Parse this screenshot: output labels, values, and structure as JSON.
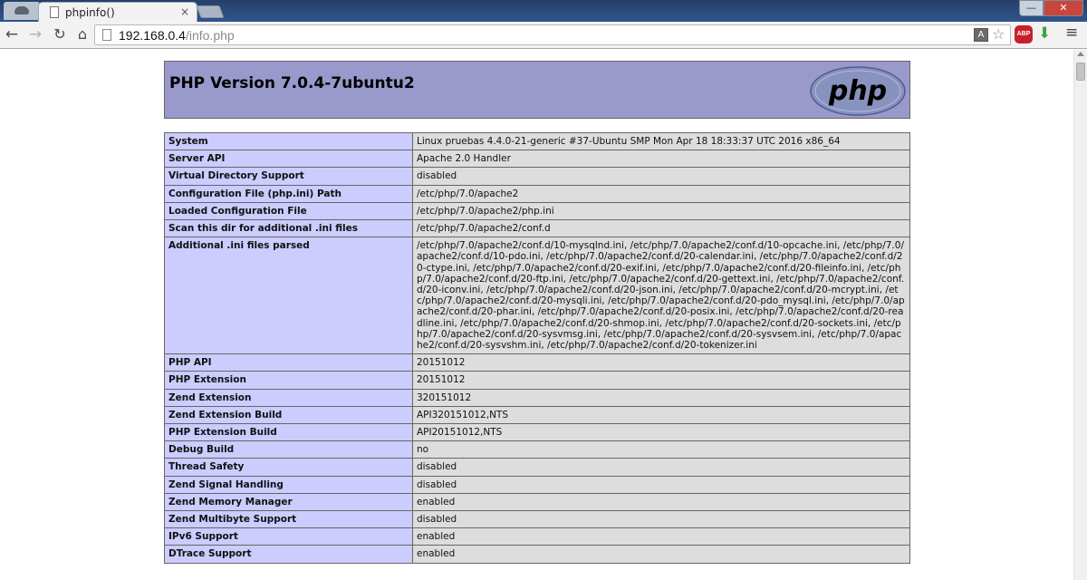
{
  "browser": {
    "tab_title": "phpinfo()",
    "tab_close": "×",
    "window_controls": {
      "minimize": "—",
      "close": "✕"
    },
    "url_host": "192.168.0.4",
    "url_path": "/info.php",
    "icons": {
      "back": "back-arrow-icon",
      "forward": "forward-arrow-icon",
      "reload": "reload-icon",
      "home": "home-icon",
      "translate": "translate-icon",
      "star": "bookmark-star-icon",
      "adblock": "adblock-plus-icon",
      "download": "download-icon",
      "menu": "menu-icon"
    },
    "adblock_label": "ABP"
  },
  "php": {
    "version_title": "PHP Version 7.0.4-7ubuntu2",
    "logo_text": "php",
    "colors": {
      "header": "#9999cc",
      "label_cell": "#ccccff",
      "value_cell": "#dddddd"
    },
    "rows": [
      {
        "label": "System",
        "value": "Linux pruebas 4.4.0-21-generic #37-Ubuntu SMP Mon Apr 18 18:33:37 UTC 2016 x86_64"
      },
      {
        "label": "Server API",
        "value": "Apache 2.0 Handler"
      },
      {
        "label": "Virtual Directory Support",
        "value": "disabled"
      },
      {
        "label": "Configuration File (php.ini) Path",
        "value": "/etc/php/7.0/apache2"
      },
      {
        "label": "Loaded Configuration File",
        "value": "/etc/php/7.0/apache2/php.ini"
      },
      {
        "label": "Scan this dir for additional .ini files",
        "value": "/etc/php/7.0/apache2/conf.d"
      },
      {
        "label": "Additional .ini files parsed",
        "value": "/etc/php/7.0/apache2/conf.d/10-mysqlnd.ini, /etc/php/7.0/apache2/conf.d/10-opcache.ini, /etc/php/7.0/apache2/conf.d/10-pdo.ini, /etc/php/7.0/apache2/conf.d/20-calendar.ini, /etc/php/7.0/apache2/conf.d/20-ctype.ini, /etc/php/7.0/apache2/conf.d/20-exif.ini, /etc/php/7.0/apache2/conf.d/20-fileinfo.ini, /etc/php/7.0/apache2/conf.d/20-ftp.ini, /etc/php/7.0/apache2/conf.d/20-gettext.ini, /etc/php/7.0/apache2/conf.d/20-iconv.ini, /etc/php/7.0/apache2/conf.d/20-json.ini, /etc/php/7.0/apache2/conf.d/20-mcrypt.ini, /etc/php/7.0/apache2/conf.d/20-mysqli.ini, /etc/php/7.0/apache2/conf.d/20-pdo_mysql.ini, /etc/php/7.0/apache2/conf.d/20-phar.ini, /etc/php/7.0/apache2/conf.d/20-posix.ini, /etc/php/7.0/apache2/conf.d/20-readline.ini, /etc/php/7.0/apache2/conf.d/20-shmop.ini, /etc/php/7.0/apache2/conf.d/20-sockets.ini, /etc/php/7.0/apache2/conf.d/20-sysvmsg.ini, /etc/php/7.0/apache2/conf.d/20-sysvsem.ini, /etc/php/7.0/apache2/conf.d/20-sysvshm.ini, /etc/php/7.0/apache2/conf.d/20-tokenizer.ini"
      },
      {
        "label": "PHP API",
        "value": "20151012"
      },
      {
        "label": "PHP Extension",
        "value": "20151012"
      },
      {
        "label": "Zend Extension",
        "value": "320151012"
      },
      {
        "label": "Zend Extension Build",
        "value": "API320151012,NTS"
      },
      {
        "label": "PHP Extension Build",
        "value": "API20151012,NTS"
      },
      {
        "label": "Debug Build",
        "value": "no"
      },
      {
        "label": "Thread Safety",
        "value": "disabled"
      },
      {
        "label": "Zend Signal Handling",
        "value": "disabled"
      },
      {
        "label": "Zend Memory Manager",
        "value": "enabled"
      },
      {
        "label": "Zend Multibyte Support",
        "value": "disabled"
      },
      {
        "label": "IPv6 Support",
        "value": "enabled"
      },
      {
        "label": "DTrace Support",
        "value": "enabled"
      }
    ]
  }
}
